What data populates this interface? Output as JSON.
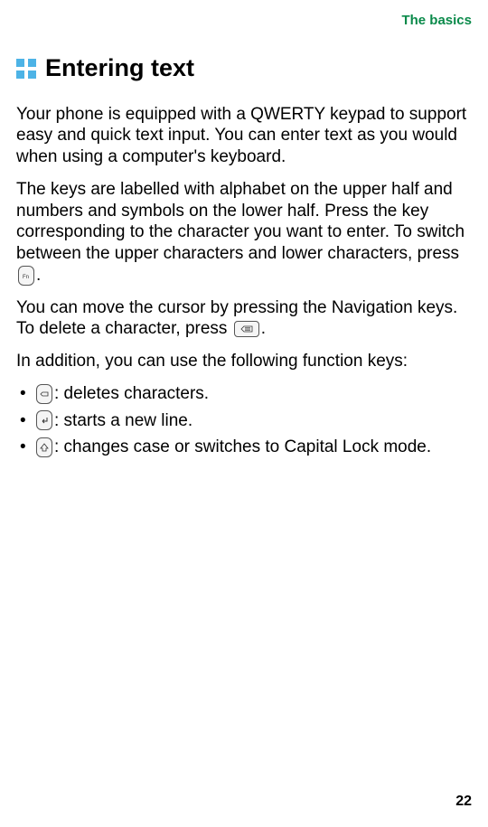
{
  "header": {
    "section_label": "The basics"
  },
  "heading": {
    "text": "Entering text"
  },
  "paragraphs": {
    "p1": "Your phone is equipped with a QWERTY keypad to support easy and quick text input. You can enter text as you would when using a computer's keyboard.",
    "p2": "The keys are labelled with alphabet on the upper half and numbers and symbols on the lower half. Press the key corresponding to the character you want to enter. To switch between the upper characters and lower characters, press ",
    "p2_after": ".",
    "p3_before": "You can move the cursor by pressing the Navigation keys. To delete a character, press ",
    "p3_after": ".",
    "p4": "In addition, you can use the following function keys:"
  },
  "bullets": {
    "b1_after": ": deletes characters.",
    "b2_after": ": starts a new line.",
    "b3_after": ": changes case or switches to Capital Lock mode."
  },
  "icons": {
    "fn_key": "fn-key-icon",
    "delete_key": "delete-key-icon",
    "backspace_key": "backspace-key-icon",
    "enter_key": "enter-key-icon",
    "shift_key": "shift-key-icon"
  },
  "page_number": "22"
}
